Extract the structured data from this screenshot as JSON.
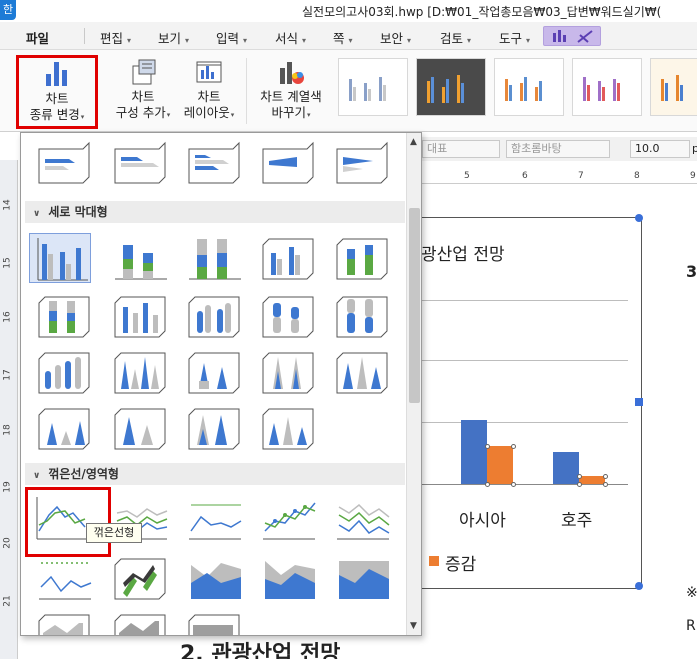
{
  "window": {
    "app_logo": "한",
    "title": "실전모의고사03회.hwp [D:₩01_작업총모음₩03_답변₩워드실기₩("
  },
  "menu": {
    "items": [
      "파일",
      "편집",
      "보기",
      "입력",
      "서식",
      "쪽",
      "보안",
      "검토",
      "도구"
    ],
    "chevron": "▾"
  },
  "ribbon": {
    "chart_type": {
      "line1": "차트",
      "line2": "종류 변경"
    },
    "chart_compose": {
      "line1": "차트",
      "line2": "구성 추가"
    },
    "chart_layout": {
      "line1": "차트",
      "line2": "레이아웃"
    },
    "series_color": {
      "line1": "차트 계열색",
      "line2": "바꾸기"
    },
    "dropdown_arrow": "▾"
  },
  "format_bar": {
    "style_value": "대표",
    "font_value": "함초롬바탕",
    "size_value": "10.0",
    "unit": "p"
  },
  "ruler": {
    "h_ticks": [
      "5",
      "6",
      "7",
      "8",
      "9"
    ],
    "v_ticks": [
      "14",
      "15",
      "16",
      "17",
      "18",
      "19",
      "20",
      "21"
    ]
  },
  "document": {
    "chart_title_fragment": "광산업 전망",
    "chart_categories": [
      "아시아",
      "호주"
    ],
    "legend_label": "증감",
    "side_digit": "3",
    "side_mark": "※",
    "side_letter": "R",
    "heading_fragment": "2. 관광산업 전망"
  },
  "chart_type_panel": {
    "sections": {
      "vertical_bar": "세로 막대형",
      "line_area": "꺾은선/영역형"
    },
    "tooltip": "꺾은선형",
    "scroll_up": "▲",
    "scroll_down": "▼"
  },
  "chart_data": {
    "type": "bar",
    "categories": [
      "아시아",
      "호주"
    ],
    "series": [
      {
        "name": "",
        "values": [
          64,
          32
        ]
      },
      {
        "name": "증감",
        "values": [
          38,
          8
        ]
      }
    ],
    "colors": [
      "#4472c4",
      "#ed7d31"
    ],
    "title": "광산업 전망"
  },
  "colors": {
    "accent_red": "#e00000",
    "chart_blue": "#4472c4",
    "chart_orange": "#ed7d31",
    "selection_blue": "#3a6fd8"
  }
}
